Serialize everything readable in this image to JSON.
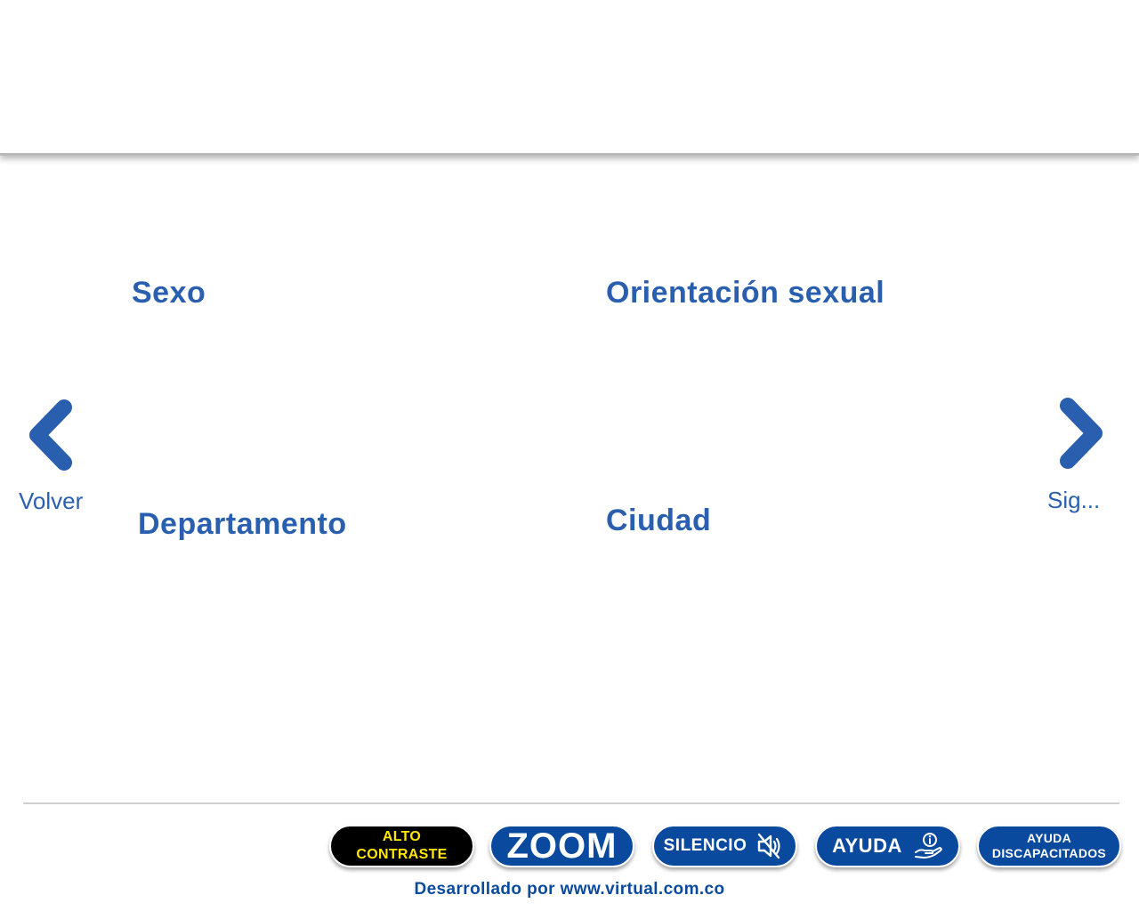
{
  "fields": {
    "sexo": "Sexo",
    "orientacion": "Orientación sexual",
    "departamento": "Departamento",
    "ciudad": "Ciudad"
  },
  "nav": {
    "back_label": "Volver",
    "next_label": "Sig..."
  },
  "accessibility": {
    "contrast_line1": "ALTO",
    "contrast_line2": "CONTRASTE",
    "zoom_label": "ZOOM",
    "silence_label": "SILENCIO",
    "help_label": "AYUDA",
    "disabled_line1": "AYUDA",
    "disabled_line2": "DISCAPACITADOS"
  },
  "footer": {
    "credit": "Desarrollado por www.virtual.com.co"
  },
  "colors": {
    "primary_blue": "#2a5fb0",
    "button_blue": "#0a4a9e",
    "contrast_bg": "#000000",
    "contrast_text": "#ffe600"
  },
  "icons": {
    "back": "chevron-left-icon",
    "next": "chevron-right-icon",
    "silence": "speaker-mute-icon",
    "help": "hand-info-icon"
  }
}
